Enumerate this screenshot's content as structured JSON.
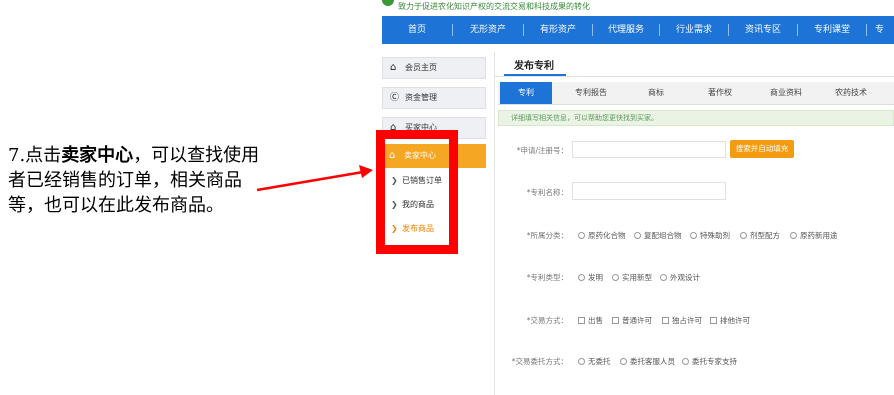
{
  "header": {
    "tagline": "致力于促进农化知识产权的交流交易和科技成果的转化"
  },
  "nav": {
    "items": [
      "首页",
      "无形资产",
      "有形资产",
      "代理服务",
      "行业需求",
      "资讯专区",
      "专利课堂",
      "专"
    ]
  },
  "sidebar": {
    "member_home": "会员主页",
    "funds": "资金管理",
    "buyer_center": "买家中心",
    "seller_center": "卖家中心",
    "sold_orders": "已销售订单",
    "my_products": "我的商品",
    "publish_product": "发布商品"
  },
  "annotation": {
    "prefix": "7.点击",
    "bold": "卖家中心",
    "rest": "，可以查找使用者已经销售的订单，相关商品等，也可以在此发布商品。"
  },
  "main": {
    "page_title": "发布专利",
    "tabs": [
      "专利",
      "专利报告",
      "商标",
      "著作权",
      "商业资料",
      "农药技术"
    ],
    "hint": "详细填写相关信息，可以帮助您更快找到买家。",
    "fields": {
      "app_no_label": "*申请/注册号：",
      "autofill_button": "搜索并自动填充",
      "name_label": "*专利名称：",
      "category_label": "*所属分类：",
      "category_options": [
        "原药化合物",
        "复配组合物",
        "特殊助剂",
        "剂型配方",
        "原药新用途"
      ],
      "type_label": "*专利类型：",
      "type_options": [
        "发明",
        "实用新型",
        "外观设计"
      ],
      "trade_label": "*交易方式：",
      "trade_options": [
        "出售",
        "普通许可",
        "独占许可",
        "排他许可"
      ],
      "delegate_label": "*交易委托方式：",
      "delegate_options": [
        "无委托",
        "委托客服人员",
        "委托专家支持"
      ]
    }
  },
  "colors": {
    "nav_blue": "#1e73d6",
    "seller_orange": "#f5a623",
    "highlight_red": "#ff0000",
    "autofill_orange": "#f39c12"
  }
}
